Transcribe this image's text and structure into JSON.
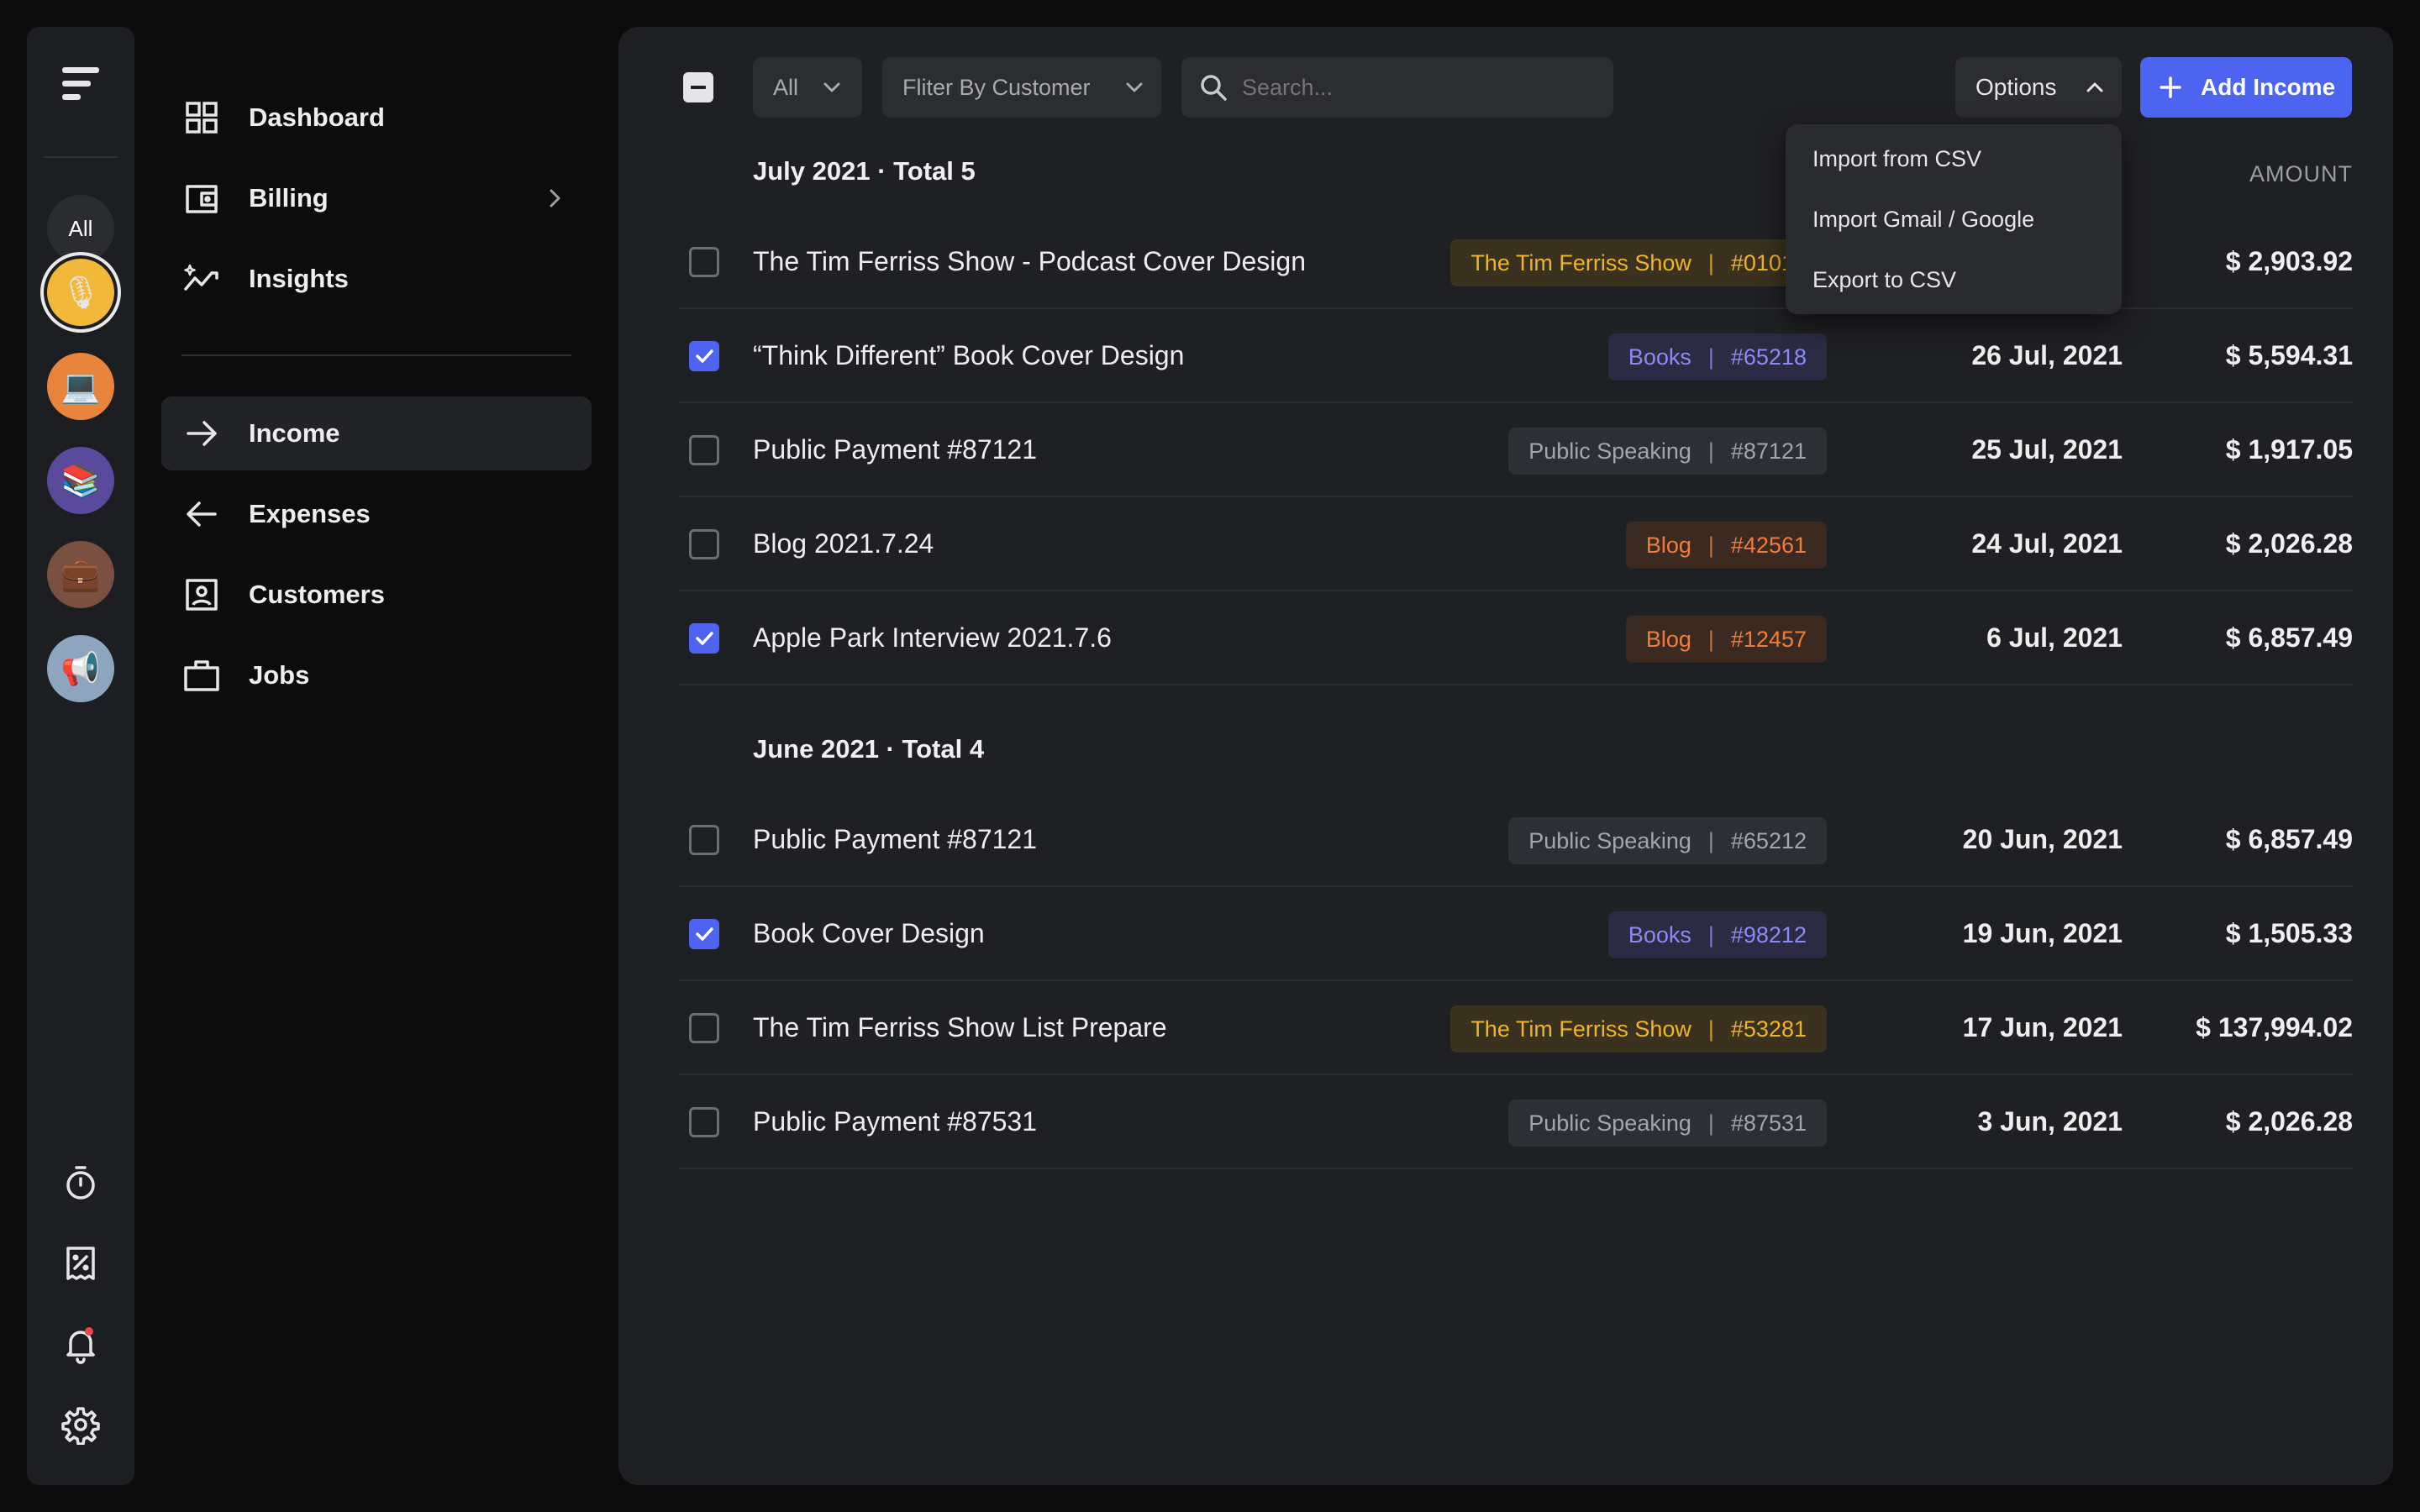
{
  "rail": {
    "all_label": "All",
    "avatars": [
      {
        "name": "microphone-avatar",
        "glyph": "🎙",
        "bg": "#f2b83a",
        "selected": true
      },
      {
        "name": "laptop-avatar",
        "glyph": "💻",
        "bg": "#e8843c",
        "selected": false
      },
      {
        "name": "books-avatar",
        "glyph": "📚",
        "bg": "#5a4a9c",
        "selected": false
      },
      {
        "name": "briefcase-avatar",
        "glyph": "💼",
        "bg": "#7a5040",
        "selected": false
      },
      {
        "name": "megaphone-avatar",
        "glyph": "📢",
        "bg": "#8ea5c0",
        "selected": false
      }
    ],
    "notification_dot_color": "#e5484d"
  },
  "nav": {
    "dashboard": "Dashboard",
    "billing": "Billing",
    "insights": "Insights",
    "income": "Income",
    "expenses": "Expenses",
    "customers": "Customers",
    "jobs": "Jobs"
  },
  "toolbar": {
    "filter_all": "All",
    "filter_customer": "Fliter By Customer",
    "search_placeholder": "Search...",
    "options_label": "Options",
    "add_label": "Add Income"
  },
  "options_menu": {
    "items": [
      "Import from CSV",
      "Import Gmail / Google",
      "Export to CSV"
    ]
  },
  "table": {
    "amount_header": "AMOUNT"
  },
  "groups": [
    {
      "header": "July 2021 · Total 5",
      "rows": [
        {
          "title": "The Tim Ferriss Show - Podcast Cover Design",
          "tag": "The Tim Ferriss Show",
          "code": "#01017",
          "tag_type": "yellow",
          "date": "",
          "amount": "$ 2,903.92",
          "checked": false
        },
        {
          "title": "“Think Different” Book Cover Design",
          "tag": "Books",
          "code": "#65218",
          "tag_type": "purple",
          "date": "26 Jul, 2021",
          "amount": "$ 5,594.31",
          "checked": true
        },
        {
          "title": "Public Payment #87121",
          "tag": "Public Speaking",
          "code": "#87121",
          "tag_type": "gray",
          "date": "25 Jul, 2021",
          "amount": "$ 1,917.05",
          "checked": false
        },
        {
          "title": "Blog 2021.7.24",
          "tag": "Blog",
          "code": "#42561",
          "tag_type": "orange",
          "date": "24 Jul, 2021",
          "amount": "$ 2,026.28",
          "checked": false
        },
        {
          "title": "Apple Park Interview 2021.7.6",
          "tag": "Blog",
          "code": "#12457",
          "tag_type": "orange",
          "date": "6 Jul, 2021",
          "amount": "$ 6,857.49",
          "checked": true
        }
      ]
    },
    {
      "header": "June 2021 · Total 4",
      "rows": [
        {
          "title": "Public Payment #87121",
          "tag": "Public Speaking",
          "code": "#65212",
          "tag_type": "gray",
          "date": "20 Jun, 2021",
          "amount": "$ 6,857.49",
          "checked": false
        },
        {
          "title": "Book Cover Design",
          "tag": "Books",
          "code": "#98212",
          "tag_type": "purple",
          "date": "19 Jun, 2021",
          "amount": "$ 1,505.33",
          "checked": true
        },
        {
          "title": "The Tim Ferriss Show List Prepare",
          "tag": "The Tim Ferriss Show",
          "code": "#53281",
          "tag_type": "yellow",
          "date": "17 Jun, 2021",
          "amount": "$ 137,994.02",
          "checked": false
        },
        {
          "title": "Public Payment #87531",
          "tag": "Public Speaking",
          "code": "#87531",
          "tag_type": "gray",
          "date": "3 Jun, 2021",
          "amount": "$ 2,026.28",
          "checked": false
        }
      ]
    }
  ],
  "tag_colors": {
    "yellow": {
      "bg": "#3a321f",
      "fg": "#f0b429"
    },
    "purple": {
      "bg": "#2b2c44",
      "fg": "#8a8cf5"
    },
    "gray": {
      "bg": "#2d2f34",
      "fg": "#a3a6ad"
    },
    "orange": {
      "bg": "#3a2a22",
      "fg": "#ef7d3c"
    }
  },
  "accent_color": "#4d64f0"
}
